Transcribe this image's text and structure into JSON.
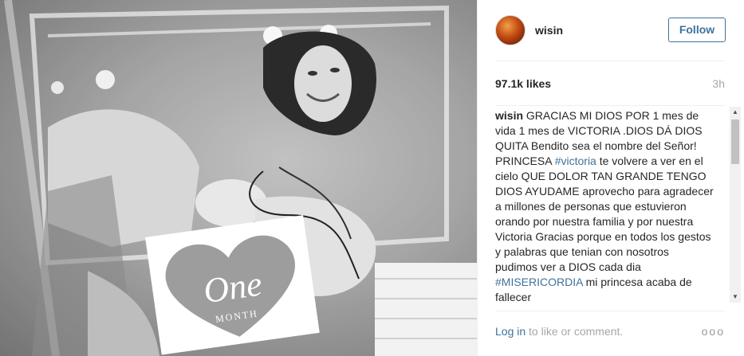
{
  "post": {
    "photo": {
      "card_text": "One",
      "card_subtext": "MONTH"
    },
    "header": {
      "username": "wisin",
      "follow_label": "Follow"
    },
    "stats": {
      "likes": "97.1k likes",
      "time": "3h"
    },
    "caption": {
      "author": "wisin",
      "text_before_tag1": "GRACIAS MI DIOS POR 1 mes de vida 1 mes de VICTORIA .DIOS DÁ DIOS QUITA Bendito sea el nombre del Señor! PRINCESA ",
      "tag1": "#victoria",
      "text_between": " te volvere a ver en el cielo QUE DOLOR TAN GRANDE TENGO DIOS AYUDAME aprovecho para agradecer a millones de personas que estuvieron orando por nuestra familia y por nuestra Victoria Gracias porque en todos los gestos y palabras que tenian con nosotros pudimos ver a DIOS cada dia ",
      "tag2": "#MISERICORDIA",
      "text_after": " mi princesa acaba de fallecer"
    },
    "footer": {
      "login_link": "Log in",
      "login_rest": " to like or comment.",
      "more_label": "ooo"
    },
    "scrollbar": {
      "up": "▲",
      "down": "▼"
    }
  }
}
